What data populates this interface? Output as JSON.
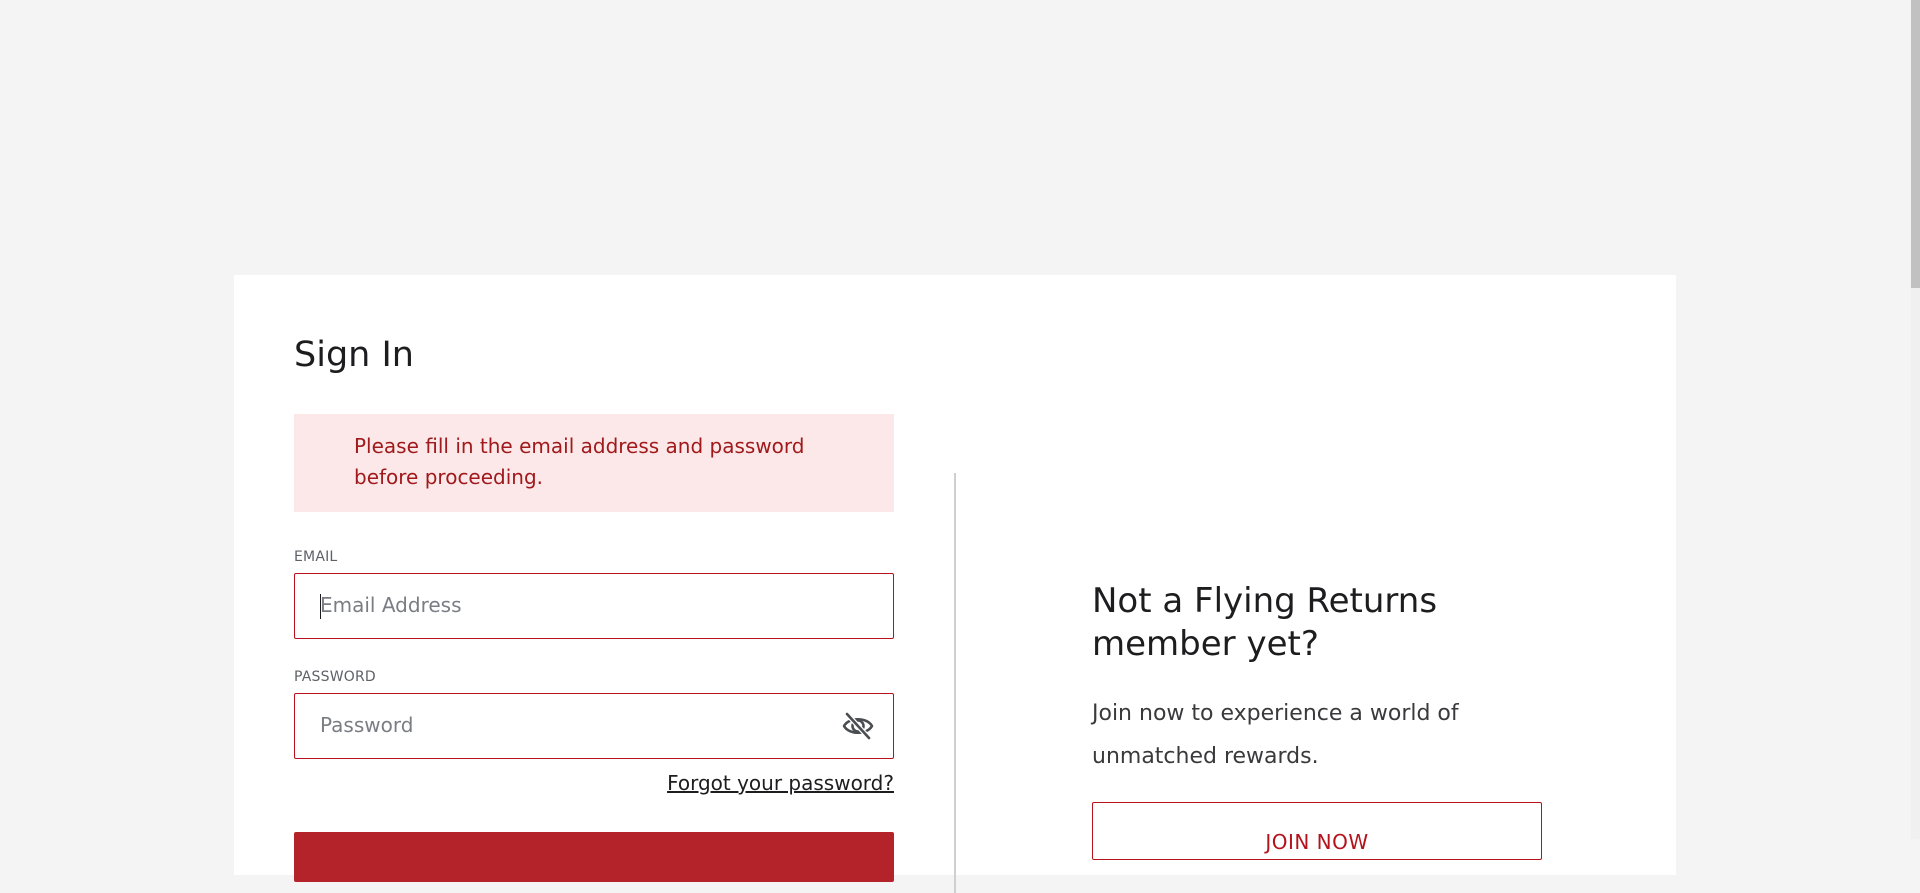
{
  "signin": {
    "title": "Sign In",
    "error_message": "Please fill in the email address and password before proceeding.",
    "email": {
      "label": "EMAIL",
      "placeholder": "Email Address",
      "value": ""
    },
    "password": {
      "label": "PASSWORD",
      "placeholder": "Password",
      "value": "",
      "toggle_icon": "eye-off-icon"
    },
    "forgot_password_link": "Forgot your password?"
  },
  "promo": {
    "heading": "Not a Flying Returns member yet?",
    "text": "Join now to experience a world of unmatched rewards.",
    "join_button": "JOIN NOW"
  },
  "colors": {
    "accent": "#b5121b",
    "error_background": "#fce8e8",
    "error_text": "#a0191c",
    "page_background": "#f4f4f4"
  }
}
